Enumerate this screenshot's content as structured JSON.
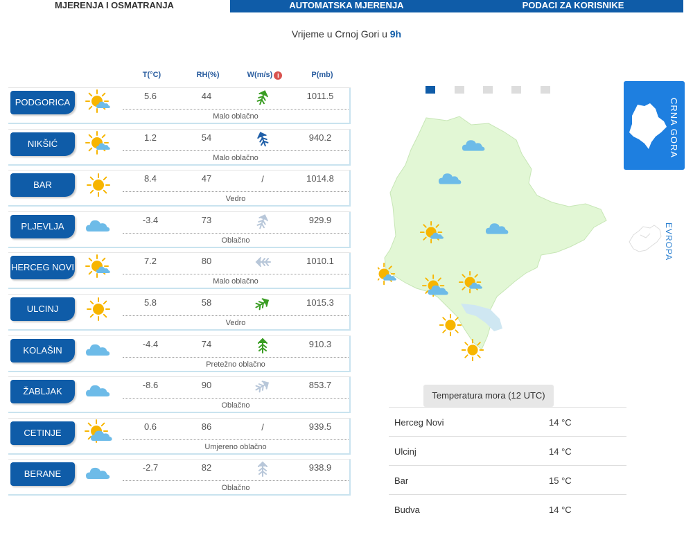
{
  "tabs": [
    {
      "label": "MJERENJA I OSMATRANJA"
    },
    {
      "label": "AUTOMATSKA MJERENJA"
    },
    {
      "label": "PODACI ZA KORISNIKE"
    }
  ],
  "headline": {
    "prefix": "Vrijeme u Crnoj Gori u ",
    "hour": "9h"
  },
  "columns": {
    "t": "T(°C)",
    "rh": "RH(%)",
    "w": "W(m/s)",
    "info": "i",
    "p": "P(mb)"
  },
  "colors": {
    "brand": "#0f5ca8",
    "accent": "#1e7fe0",
    "map_fill": "#e2f7d5",
    "lake": "#cfe7f2",
    "sun": "#f7b500",
    "cloud": "#5ab0e4"
  },
  "stations": [
    {
      "name": "PODGORICA",
      "icon": "sun-cloud-icon",
      "t": "5.6",
      "rh": "44",
      "wind": "arrow",
      "wind_color": "#3a9d23",
      "wind_rot": 200,
      "p": "1011.5",
      "desc": "Malo oblačno"
    },
    {
      "name": "NIKŠIĆ",
      "icon": "sun-cloud-icon",
      "t": "1.2",
      "rh": "54",
      "wind": "arrow",
      "wind_color": "#1f5fa8",
      "wind_rot": 160,
      "p": "940.2",
      "desc": "Malo oblačno"
    },
    {
      "name": "BAR",
      "icon": "sun-icon",
      "t": "8.4",
      "rh": "47",
      "wind": "text",
      "wind_text": "/",
      "p": "1014.8",
      "desc": "Vedro"
    },
    {
      "name": "PLJEVLJA",
      "icon": "cloud-icon",
      "t": "-3.4",
      "rh": "73",
      "wind": "arrow",
      "wind_color": "#b8c7d9",
      "wind_rot": 200,
      "p": "929.9",
      "desc": "Oblačno"
    },
    {
      "name": "HERCEG NOVI",
      "icon": "sun-cloud-icon",
      "t": "7.2",
      "rh": "80",
      "wind": "arrow",
      "wind_color": "#b8c7d9",
      "wind_rot": 90,
      "p": "1010.1",
      "desc": "Malo oblačno"
    },
    {
      "name": "ULCINJ",
      "icon": "sun-icon",
      "t": "5.8",
      "rh": "58",
      "wind": "arrow",
      "wind_color": "#3a9d23",
      "wind_rot": 240,
      "p": "1015.3",
      "desc": "Vedro"
    },
    {
      "name": "KOLAŠIN",
      "icon": "cloud-icon",
      "t": "-4.4",
      "rh": "74",
      "wind": "arrow",
      "wind_color": "#3a9d23",
      "wind_rot": 180,
      "p": "910.3",
      "desc": "Pretežno oblačno"
    },
    {
      "name": "ŽABLJAK",
      "icon": "cloud-icon",
      "t": "-8.6",
      "rh": "90",
      "wind": "arrow",
      "wind_color": "#b8c7d9",
      "wind_rot": 240,
      "p": "853.7",
      "desc": "Oblačno"
    },
    {
      "name": "CETINJE",
      "icon": "sun-bigcloud-icon",
      "t": "0.6",
      "rh": "86",
      "wind": "text",
      "wind_text": "/",
      "p": "939.5",
      "desc": "Umjereno oblačno"
    },
    {
      "name": "BERANE",
      "icon": "cloud-icon",
      "t": "-2.7",
      "rh": "82",
      "wind": "arrow",
      "wind_color": "#b8c7d9",
      "wind_rot": 180,
      "p": "938.9",
      "desc": "Oblačno"
    }
  ],
  "map": {
    "pager_count": 5,
    "active_page": 0,
    "side_cg": "CRNA GORA",
    "side_eu": "EVROPA",
    "markers": [
      {
        "icon": "cloud-icon"
      },
      {
        "icon": "cloud-icon"
      },
      {
        "icon": "sun-cloud-icon"
      },
      {
        "icon": "cloud-icon"
      },
      {
        "icon": "sun-cloud-icon"
      },
      {
        "icon": "sun-bigcloud-icon"
      },
      {
        "icon": "sun-cloud-icon"
      },
      {
        "icon": "sun-icon"
      },
      {
        "icon": "sun-icon"
      }
    ]
  },
  "sea": {
    "button": "Temperatura mora (12 UTC)",
    "rows": [
      {
        "place": "Herceg Novi",
        "temp": "14 °C"
      },
      {
        "place": "Ulcinj",
        "temp": "14 °C"
      },
      {
        "place": "Bar",
        "temp": "15 °C"
      },
      {
        "place": "Budva",
        "temp": "14 °C"
      }
    ]
  }
}
